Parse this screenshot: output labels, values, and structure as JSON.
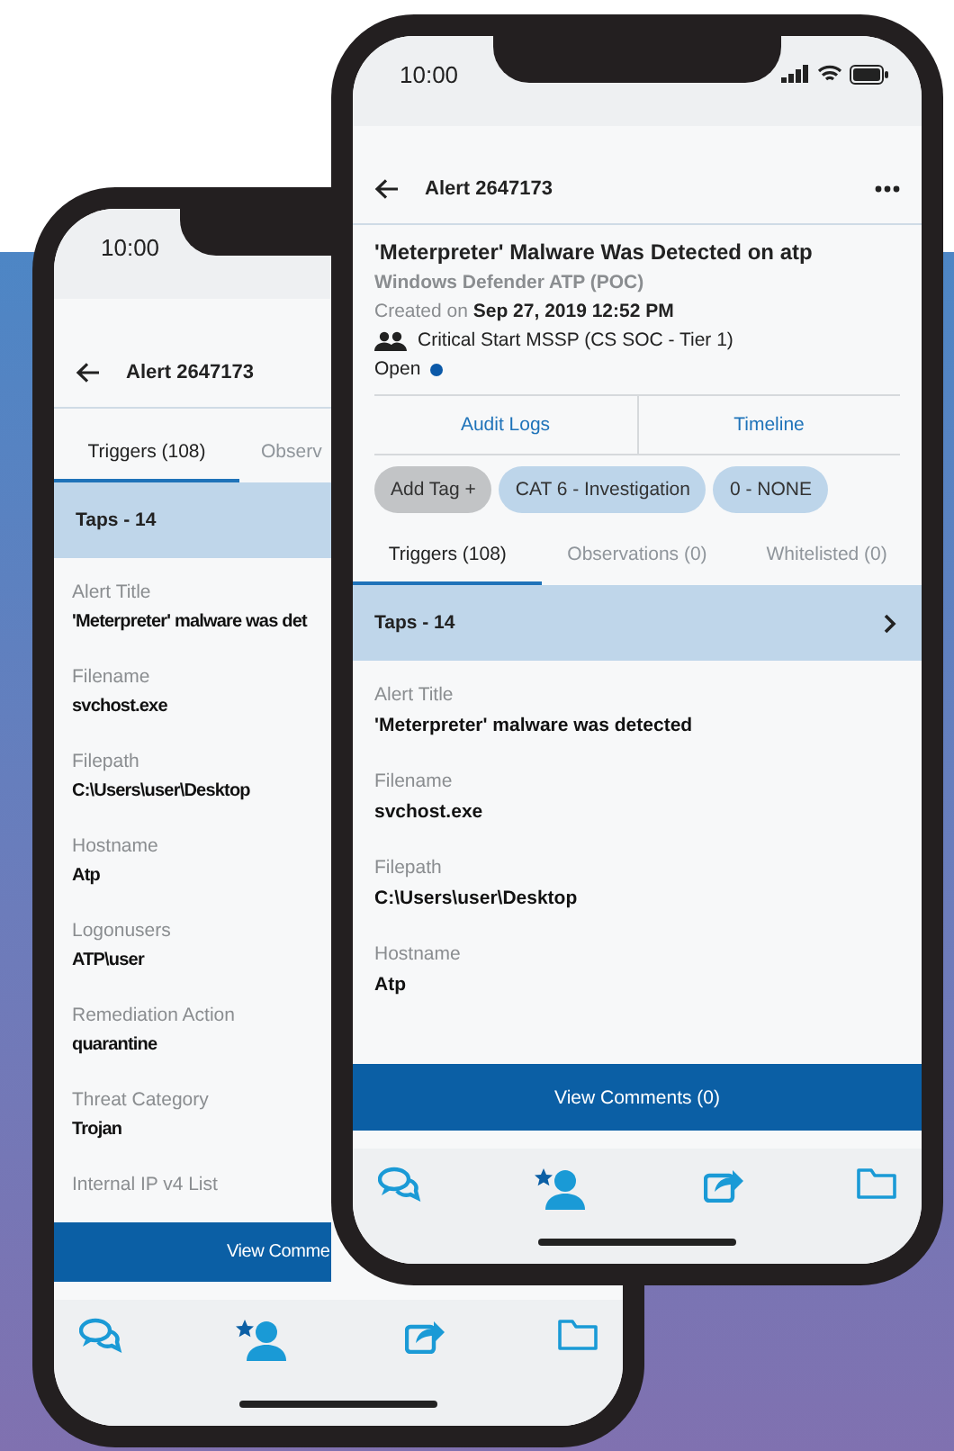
{
  "phones": [
    {
      "kind": "back",
      "time": "10:00",
      "title": "Alert 2647173",
      "tabs": [
        {
          "label": "Triggers (108)",
          "selected": true
        },
        {
          "label": "Observ",
          "selected": false
        }
      ],
      "group": {
        "label": "Taps - 14"
      },
      "fields": [
        {
          "label": "Alert Title",
          "value": "'Meterpreter' malware was det"
        },
        {
          "label": "Filename",
          "value": "svchost.exe"
        },
        {
          "label": "Filepath",
          "value": "C:\\Users\\user\\Desktop"
        },
        {
          "label": "Hostname",
          "value": "Atp"
        },
        {
          "label": "Logonusers",
          "value": "ATP\\user"
        },
        {
          "label": "Remediation Action",
          "value": "quarantine"
        },
        {
          "label": "Threat Category",
          "value": "Trojan"
        },
        {
          "label": "Internal IP v4 List"
        }
      ],
      "comments_button": "View Comme"
    },
    {
      "kind": "front",
      "time": "10:00",
      "title": "Alert 2647173",
      "alert": {
        "heading": "'Meterpreter' Malware Was Detected on atp",
        "source": "Windows Defender ATP (POC)",
        "created": "Created on **Sep 27, 2019 12:52 PM**",
        "team": "Critical Start MSSP (CS SOC - Tier 1)",
        "status": "Open"
      },
      "actions": [
        "Audit Logs",
        "Timeline"
      ],
      "tags": [
        {
          "label": "Add Tag +",
          "kind": "add"
        },
        {
          "label": "CAT 6 - Investigation",
          "kind": "tag"
        },
        {
          "label": "0 - NONE",
          "kind": "tag"
        }
      ],
      "tabs": [
        {
          "label": "Triggers (108)",
          "selected": true
        },
        {
          "label": "Observations (0)",
          "selected": false
        },
        {
          "label": "Whitelisted (0)",
          "selected": false
        }
      ],
      "group": {
        "label": "Taps - 14"
      },
      "fields": [
        {
          "label": "Alert Title",
          "value": "'Meterpreter' malware was detected"
        },
        {
          "label": "Filename",
          "value": "svchost.exe"
        },
        {
          "label": "Filepath",
          "value": "C:\\Users\\user\\Desktop"
        },
        {
          "label": "Hostname",
          "value": "Atp"
        }
      ],
      "comments_button": "View Comments (0)"
    }
  ]
}
